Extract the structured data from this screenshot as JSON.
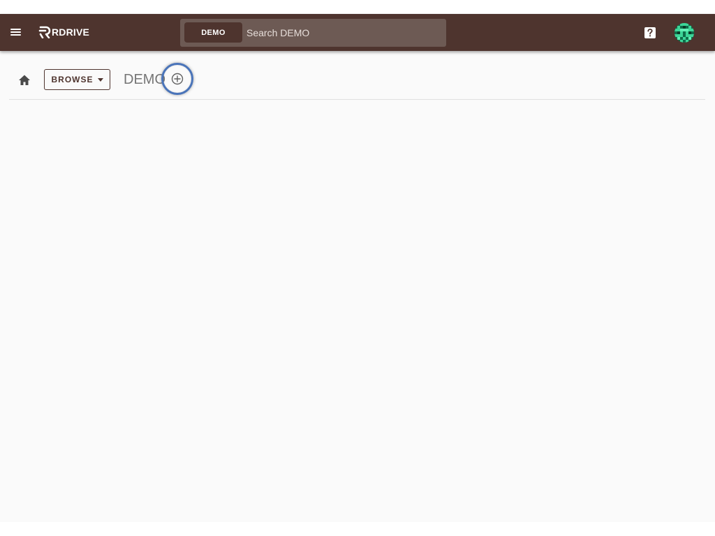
{
  "app": {
    "logo_text": "RDRIVE"
  },
  "search": {
    "scope_label": "DEMO",
    "placeholder": "Search DEMO",
    "value": ""
  },
  "toolbar": {
    "browse_label": "BROWSE",
    "title": "DEMO"
  },
  "icons": {
    "menu": "hamburger-menu-icon",
    "logo": "rdrive-logo-icon",
    "help": "help-icon",
    "avatar": "identicon-avatar",
    "home": "home-icon",
    "dropdown": "caret-down-icon",
    "add": "add-circle-icon"
  },
  "colors": {
    "appbar": "#4e342e",
    "search_bg": "#6d5a54",
    "content_bg": "#fafafa",
    "focus_ring": "#4a74b9",
    "avatar_primary": "#3dd598",
    "avatar_secondary": "#0f6e4a"
  }
}
